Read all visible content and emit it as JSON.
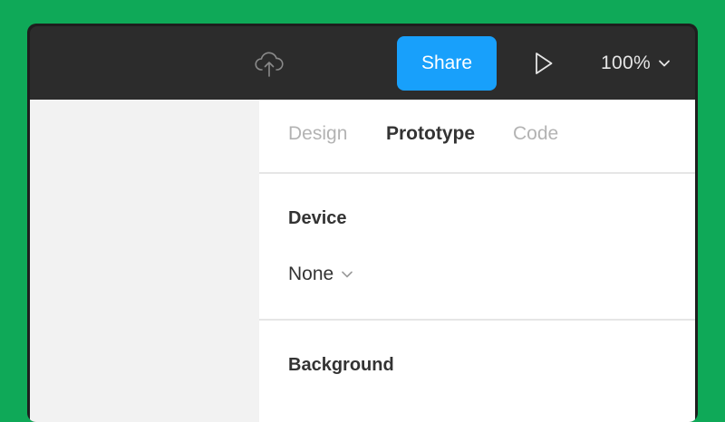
{
  "toolbar": {
    "cloud_icon": "cloud-upload-icon",
    "share_label": "Share",
    "play_icon": "play-icon",
    "zoom_value": "100%",
    "zoom_icon": "chevron-down-icon"
  },
  "panel": {
    "tabs": [
      {
        "label": "Design",
        "active": false
      },
      {
        "label": "Prototype",
        "active": true
      },
      {
        "label": "Code",
        "active": false
      }
    ],
    "device": {
      "title": "Device",
      "value": "None"
    },
    "background": {
      "title": "Background"
    }
  },
  "colors": {
    "outer_background": "#0fa958",
    "toolbar": "#2c2c2c",
    "share_button": "#18a0fb",
    "canvas": "#f2f2f2",
    "panel": "#ffffff",
    "active_tab": "#333333",
    "inactive_tab": "#b3b3b3"
  }
}
